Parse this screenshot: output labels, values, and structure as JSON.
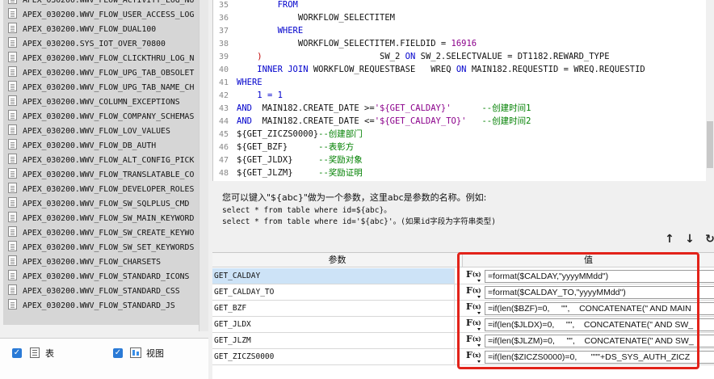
{
  "tables": [
    "APEX_030200.WWV_FLOW_ACTIVITY_LOG_NU",
    "APEX_030200.WWV_FLOW_USER_ACCESS_LOG",
    "APEX_030200.WWV_FLOW_DUAL100",
    "APEX_030200.SYS_IOT_OVER_70800",
    "APEX_030200.WWV_FLOW_CLICKTHRU_LOG_N",
    "APEX_030200.WWV_FLOW_UPG_TAB_OBSOLET",
    "APEX_030200.WWV_FLOW_UPG_TAB_NAME_CH",
    "APEX_030200.WWV_COLUMN_EXCEPTIONS",
    "APEX_030200.WWV_FLOW_COMPANY_SCHEMAS",
    "APEX_030200.WWV_FLOW_LOV_VALUES",
    "APEX_030200.WWV_FLOW_DB_AUTH",
    "APEX_030200.WWV_FLOW_ALT_CONFIG_PICK",
    "APEX_030200.WWV_FLOW_TRANSLATABLE_CO",
    "APEX_030200.WWV_FLOW_DEVELOPER_ROLES",
    "APEX_030200.WWV_FLOW_SW_SQLPLUS_CMD",
    "APEX_030200.WWV_FLOW_SW_MAIN_KEYWORD",
    "APEX_030200.WWV_FLOW_SW_CREATE_KEYWO",
    "APEX_030200.WWV_FLOW_SW_SET_KEYWORDS",
    "APEX_030200.WWV_FLOW_CHARSETS",
    "APEX_030200.WWV_FLOW_STANDARD_ICONS",
    "APEX_030200.WWV_FLOW_STANDARD_CSS",
    "APEX_030200.WWV_FLOW_STANDARD_JS"
  ],
  "filters": {
    "table_label": "表",
    "view_label": "视图"
  },
  "editor": {
    "line_numbers": [
      "35",
      "36",
      "37",
      "38",
      "39",
      "40",
      "41",
      "42",
      "43",
      "44",
      "45",
      "46",
      "47",
      "48"
    ],
    "code": {
      "l35_kw": "FROM",
      "l36": "WORKFLOW_SELECTITEM",
      "l37_kw": "WHERE",
      "l38_a": "WORKFLOW_SELECTITEM.FIELDID = ",
      "l38_num": "16916",
      "l39_paren": ")",
      "l39_a": "SW_2 ",
      "l39_on": "ON",
      "l39_b": " SW_2.SELECTVALUE = DT1182.REWARD_TYPE",
      "l40_kw1": "INNER JOIN",
      "l40_a": " WORKFLOW_REQUESTBASE   WREQ ",
      "l40_on": "ON",
      "l40_b": " MAIN182.REQUESTID = WREQ.REQUESTID",
      "l41_kw": "WHERE",
      "l42": "1 = 1",
      "l43_and": "AND",
      "l43_a": "  MAIN182.CREATE_DATE >=",
      "l43_str": "'${GET_CALDAY}'",
      "l43_cm": "--创建时间1",
      "l44_and": "AND",
      "l44_a": "  MAIN182.CREATE_DATE <=",
      "l44_str": "'${GET_CALDAY_TO}'",
      "l44_cm": "--创建时间2",
      "l45_a": "${GET_ZICZS0000}",
      "l45_cm": "--创建部门",
      "l46_a": "${GET_BZF}",
      "l46_cm": "--表彰方",
      "l47_a": "${GET_JLDX}",
      "l47_cm": "--奖励对象",
      "l48_a": "${GET_JLZM}",
      "l48_cm": "--奖励证明"
    }
  },
  "hint": {
    "main": "您可以键入\"${abc}\"做为一个参数，这里abc是参数的名称。例如:",
    "example1": "select * from table where id=${abc}。",
    "example2": "select * from table where id='${abc}'。(如果id字段为字符串类型)"
  },
  "params": {
    "header_name": "参数",
    "header_value": "值",
    "fx_label": "F(x)",
    "rows": [
      {
        "name": "GET_CALDAY",
        "value": "=format($CALDAY,\"yyyyMMdd\")"
      },
      {
        "name": "GET_CALDAY_TO",
        "value": "=format($CALDAY_TO,\"yyyyMMdd\")"
      },
      {
        "name": "GET_BZF",
        "value": "=if(len($BZF)=0,     \"\",    CONCATENATE(\" AND MAIN"
      },
      {
        "name": "GET_JLDX",
        "value": "=if(len($JLDX)=0,     \"\",    CONCATENATE(\" AND SW_"
      },
      {
        "name": "GET_JLZM",
        "value": "=if(len($JLZM)=0,     \"\",    CONCATENATE(\" AND SW_"
      },
      {
        "name": "GET_ZICZS0000",
        "value": "=if(len($ZICZS0000)=0,      \"\"\"+DS_SYS_AUTH_ZICZ"
      }
    ]
  },
  "colors": {
    "highlight_box": "#e2231a",
    "selected_row": "#cde3f7"
  }
}
